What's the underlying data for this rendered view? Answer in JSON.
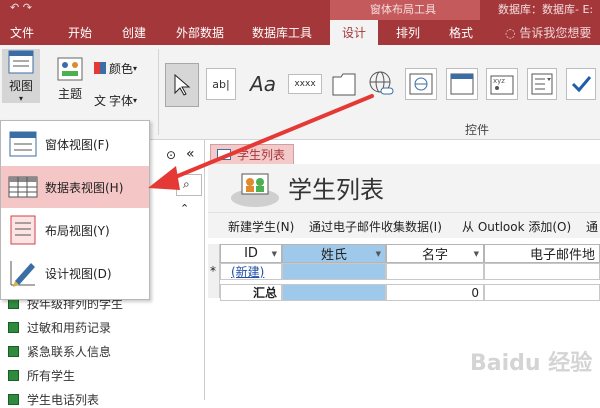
{
  "titlebar": {
    "context_label": "窗体布局工具",
    "db_label": "数据库：数据库- E:"
  },
  "menu": {
    "tabs": [
      "文件",
      "开始",
      "创建",
      "外部数据",
      "数据库工具",
      "设计",
      "排列",
      "格式"
    ],
    "active_tab": "设计",
    "tell_me": "告诉我您想要"
  },
  "ribbon": {
    "view_label": "视图",
    "theme_label": "主题",
    "colors_label": "颜色",
    "fonts_label": "字体",
    "controls_group_label": "控件",
    "textbox_glyph": "ab|",
    "label_glyph": "Aa",
    "button_glyph": "xxxx"
  },
  "view_menu": {
    "items": [
      {
        "label": "窗体视图(F)",
        "icon": "form-view-icon",
        "selected": false
      },
      {
        "label": "数据表视图(H)",
        "icon": "datasheet-view-icon",
        "selected": true
      },
      {
        "label": "布局视图(Y)",
        "icon": "layout-view-icon",
        "selected": false
      },
      {
        "label": "设计视图(D)",
        "icon": "design-view-icon",
        "selected": false
      }
    ]
  },
  "nav_pane": {
    "collapse_glyph": "«",
    "up_glyph": "⌃",
    "items": [
      "按年级排列的学生",
      "过敏和用药记录",
      "紧急联系人信息",
      "所有学生",
      "学生电话列表"
    ]
  },
  "document": {
    "tab_label": "学生列表",
    "title": "学生列表",
    "actions": [
      "新建学生(N)",
      "通过电子邮件收集数据(I)",
      "从 Outlook 添加(O)",
      "通"
    ]
  },
  "datasheet": {
    "columns": [
      "ID",
      "姓氏",
      "名字",
      "电子邮件地"
    ],
    "new_row_marker": "*",
    "new_row_id": "(新建)",
    "total_label": "汇总",
    "total_value": "0"
  },
  "watermark": "Baidu 经验",
  "colors": {
    "accent": "#a4373a",
    "selected_menu": "#f5c6c6",
    "highlight_column": "#9fc9ea",
    "arrow": "#e53935"
  }
}
